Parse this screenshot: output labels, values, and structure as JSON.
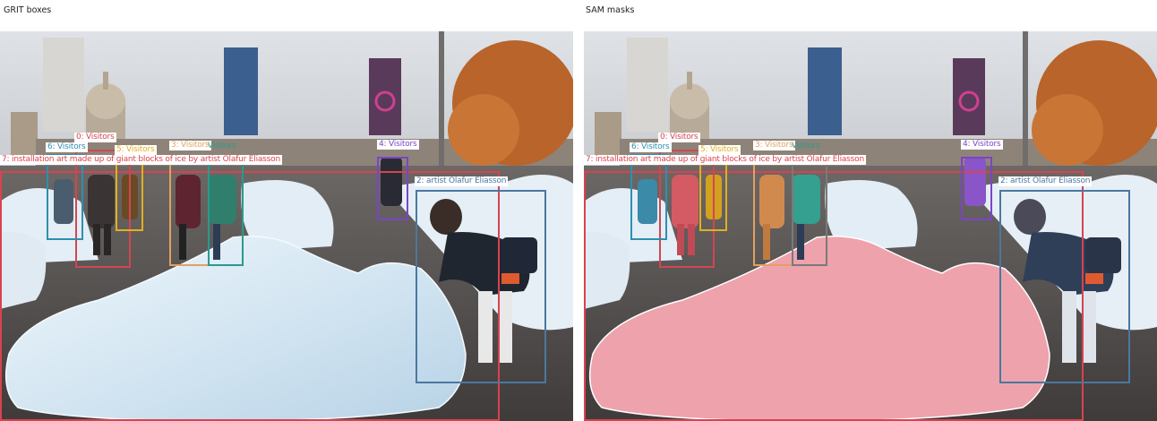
{
  "panels": {
    "left": {
      "title": "GRIT boxes"
    },
    "right": {
      "title": "SAM masks"
    }
  },
  "colors": {
    "installation_art": "#d8434f",
    "artist": "#4a78a0",
    "visitors_0": "#d24650",
    "visitors_3": "#e2a060",
    "visitors_3b": "#2a9a8e",
    "visitors_4": "#7b45c5",
    "visitors_5": "#e0b020",
    "visitors_6": "#2f8fb0",
    "mask_fill": "#f0a0aa"
  },
  "detections": [
    {
      "id": "0",
      "label": "0: Visitors",
      "color_key": "visitors_0"
    },
    {
      "id": "2",
      "label": "2: artist Olafur Eliasson",
      "color_key": "artist"
    },
    {
      "id": "3",
      "label": "3: Visitors",
      "color_key": "visitors_3"
    },
    {
      "id": "3b",
      "label": "Visitors",
      "color_key": "visitors_3b"
    },
    {
      "id": "4",
      "label": "4: Visitors",
      "color_key": "visitors_4"
    },
    {
      "id": "5",
      "label": "5: Visitors",
      "color_key": "visitors_5"
    },
    {
      "id": "6",
      "label": "6: Visitors",
      "color_key": "visitors_6"
    },
    {
      "id": "7",
      "label": "7: installation art made up of giant blocks of ice by artist Olafur Eliasson",
      "color_key": "installation_art"
    }
  ]
}
